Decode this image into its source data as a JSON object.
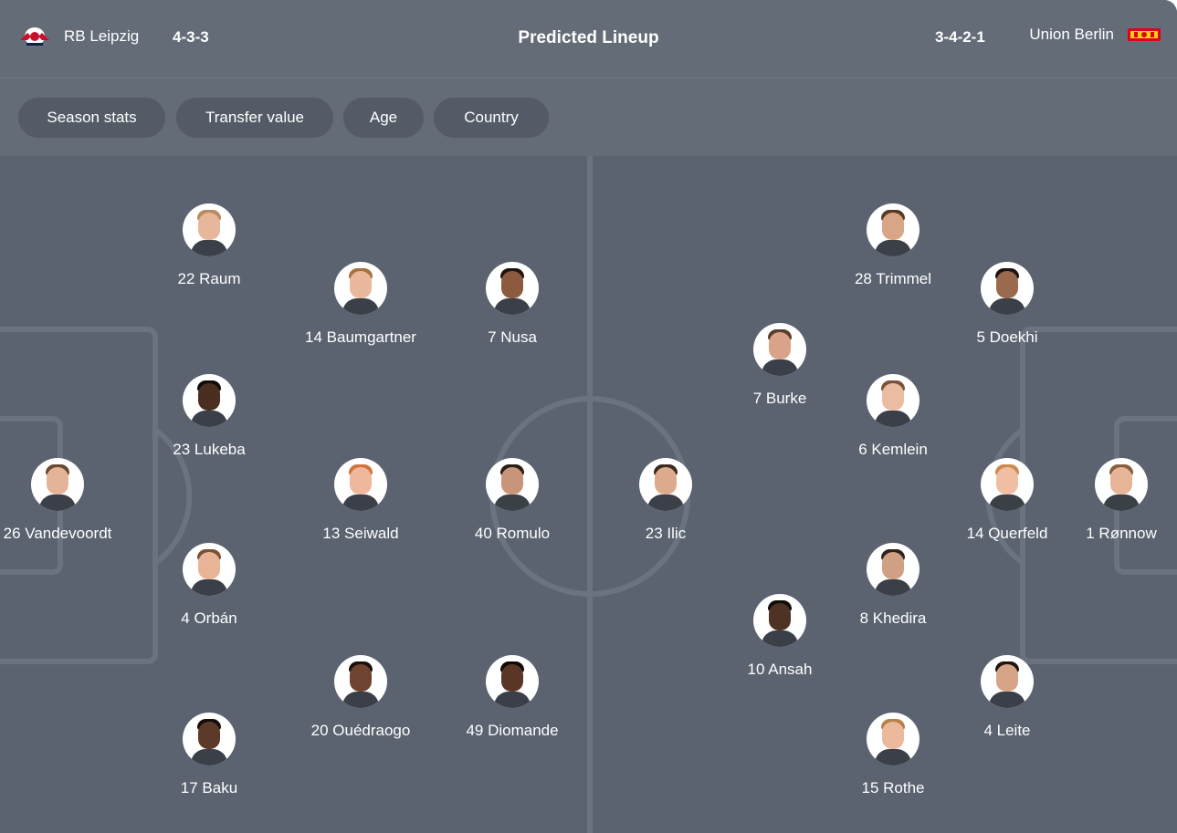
{
  "header": {
    "title": "Predicted Lineup",
    "home": {
      "name": "RB Leipzig",
      "formation": "4-3-3",
      "logo_icon": "rb-leipzig-logo-icon"
    },
    "away": {
      "name": "Union Berlin",
      "formation": "3-4-2-1",
      "logo_icon": "union-berlin-logo-icon"
    }
  },
  "filters": [
    "Season stats",
    "Transfer value",
    "Age",
    "Country"
  ],
  "home_players": [
    {
      "label": "22 Raum"
    },
    {
      "label": "14 Baumgartner"
    },
    {
      "label": "7 Nusa"
    },
    {
      "label": "23 Lukeba"
    },
    {
      "label": "26 Vandevoordt"
    },
    {
      "label": "13 Seiwald"
    },
    {
      "label": "40 Romulo"
    },
    {
      "label": "4 Orbán"
    },
    {
      "label": "20 Ouédraogo"
    },
    {
      "label": "49 Diomande"
    },
    {
      "label": "17 Baku"
    }
  ],
  "away_players": [
    {
      "label": "23 Ilic"
    },
    {
      "label": "28 Trimmel"
    },
    {
      "label": "5 Doekhi"
    },
    {
      "label": "7 Burke"
    },
    {
      "label": "6 Kemlein"
    },
    {
      "label": "14 Querfeld"
    },
    {
      "label": "1 Rønnow"
    },
    {
      "label": "8 Khedira"
    },
    {
      "label": "10 Ansah"
    },
    {
      "label": "4 Leite"
    },
    {
      "label": "15 Rothe"
    }
  ],
  "colors": {
    "pitch": "#5b6370",
    "header": "#646c78",
    "chip": "#545b67",
    "lines": "#6b7380",
    "text": "#ffffff"
  }
}
